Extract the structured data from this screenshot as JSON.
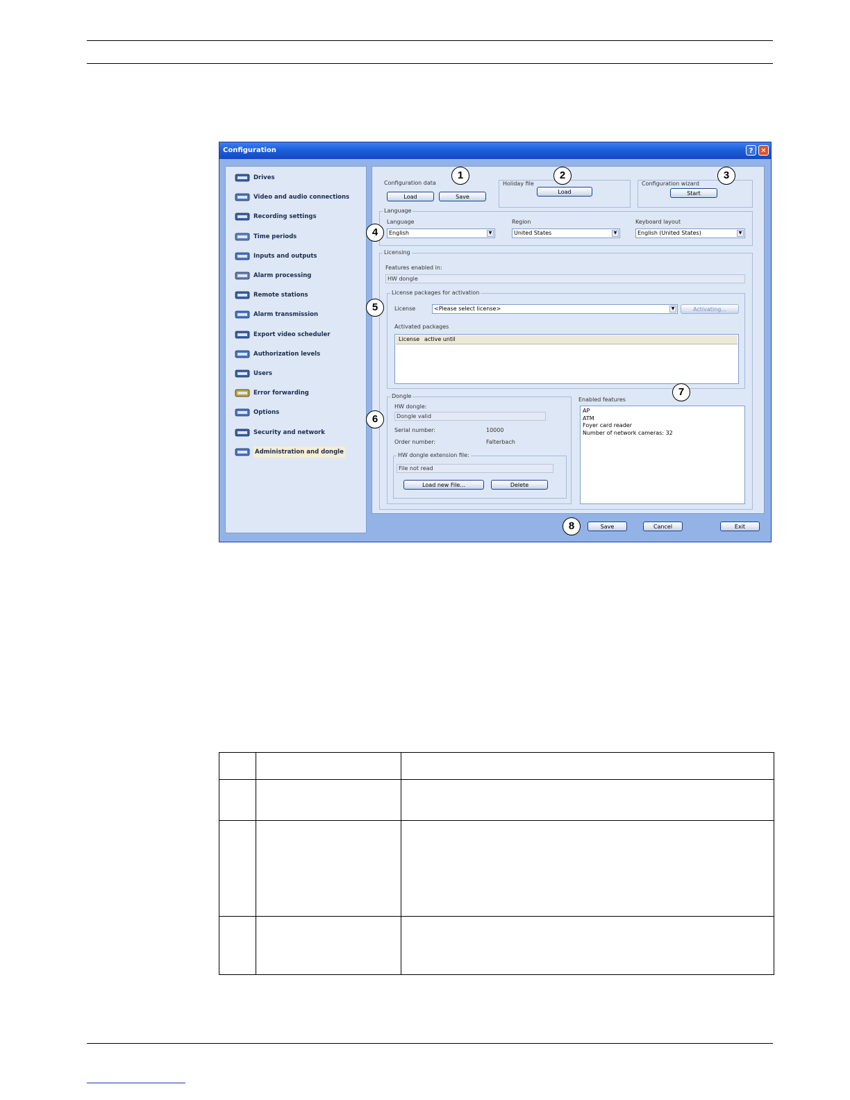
{
  "window": {
    "title": "Configuration",
    "help_label": "?",
    "close_label": "✕"
  },
  "nav": {
    "items": [
      {
        "label": "Drives",
        "icon": "drive-icon"
      },
      {
        "label": "Video and audio connections",
        "icon": "video-connection-icon"
      },
      {
        "label": "Recording settings",
        "icon": "recording-icon"
      },
      {
        "label": "Time periods",
        "icon": "calendar-icon"
      },
      {
        "label": "Inputs and outputs",
        "icon": "io-icon"
      },
      {
        "label": "Alarm processing",
        "icon": "gears-icon"
      },
      {
        "label": "Remote stations",
        "icon": "monitor-icon"
      },
      {
        "label": "Alarm transmission",
        "icon": "network-icon"
      },
      {
        "label": "Export video scheduler",
        "icon": "export-icon"
      },
      {
        "label": "Authorization levels",
        "icon": "users-group-icon"
      },
      {
        "label": "Users",
        "icon": "users-icon"
      },
      {
        "label": "Error forwarding",
        "icon": "warning-icon"
      },
      {
        "label": "Options",
        "icon": "speaker-icon"
      },
      {
        "label": "Security and network",
        "icon": "lock-icon"
      },
      {
        "label": "Administration and dongle",
        "icon": "tools-icon"
      }
    ],
    "selected_index": 14
  },
  "config_data": {
    "title": "Configuration data",
    "load_label": "Load",
    "save_label": "Save"
  },
  "holiday_file": {
    "title": "Holiday file",
    "load_label": "Load"
  },
  "config_wizard": {
    "title": "Configuration wizard",
    "start_label": "Start"
  },
  "language": {
    "title": "Language",
    "language_label": "Language",
    "language_value": "English",
    "region_label": "Region",
    "region_value": "United States",
    "keyboard_label": "Keyboard layout",
    "keyboard_value": "English (United States)"
  },
  "licensing": {
    "title": "Licensing",
    "features_enabled_label": "Features enabled in:",
    "features_enabled_value": "HW dongle",
    "packages_title": "License packages for activation",
    "license_label": "License",
    "license_value": "<Please select license>",
    "activating_label": "Activating...",
    "activated_label": "Activated packages",
    "col_license": "License",
    "col_active_until": "active until"
  },
  "dongle": {
    "title": "Dongle",
    "hw_label": "HW dongle:",
    "hw_value": "Dongle valid",
    "serial_label": "Serial number:",
    "serial_value": "10000",
    "order_label": "Order number:",
    "order_value": "Falterbach",
    "ext_title": "HW dongle extension file:",
    "ext_value": "File not read",
    "load_new_label": "Load new File...",
    "delete_label": "Delete"
  },
  "enabled_features": {
    "title": "Enabled features",
    "items": [
      "AP",
      "ATM",
      "Foyer card reader",
      "Number of network cameras: 32"
    ]
  },
  "footer_buttons": {
    "save_label": "Save",
    "cancel_label": "Cancel",
    "exit_label": "Exit"
  },
  "callouts": [
    "1",
    "2",
    "3",
    "4",
    "5",
    "6",
    "7",
    "8"
  ]
}
